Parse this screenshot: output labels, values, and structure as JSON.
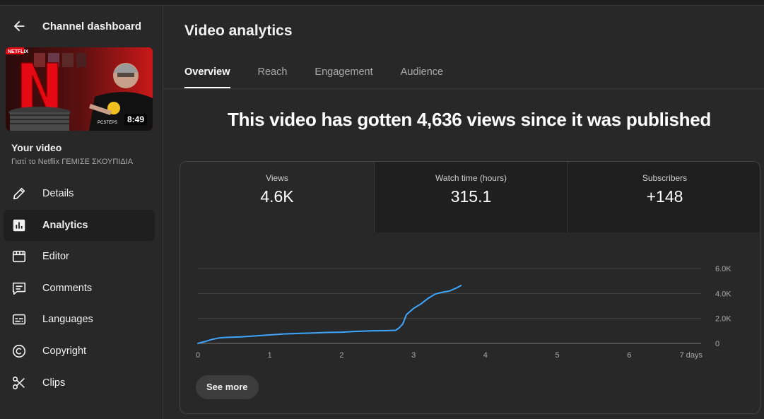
{
  "sidebar": {
    "header_title": "Channel dashboard",
    "video_duration": "8:49",
    "your_video_label": "Your video",
    "video_title": "Γιατί το Netflix ΓΕΜΙΣΕ ΣΚΟΥΠΙΔΙΑ",
    "items": [
      {
        "label": "Details",
        "icon": "pencil-icon"
      },
      {
        "label": "Analytics",
        "icon": "analytics-icon",
        "active": true
      },
      {
        "label": "Editor",
        "icon": "editor-icon"
      },
      {
        "label": "Comments",
        "icon": "comments-icon"
      },
      {
        "label": "Languages",
        "icon": "subtitles-icon"
      },
      {
        "label": "Copyright",
        "icon": "copyright-icon"
      },
      {
        "label": "Clips",
        "icon": "scissors-icon"
      }
    ]
  },
  "main": {
    "title": "Video analytics",
    "tabs": [
      "Overview",
      "Reach",
      "Engagement",
      "Audience"
    ],
    "active_tab": "Overview",
    "headline": "This video has gotten 4,636 views since it was published",
    "metrics": [
      {
        "label": "Views",
        "value": "4.6K"
      },
      {
        "label": "Watch time (hours)",
        "value": "315.1"
      },
      {
        "label": "Subscribers",
        "value": "+148"
      }
    ],
    "see_more_label": "See more"
  },
  "chart_data": {
    "type": "line",
    "x_tick_labels": [
      "0",
      "1",
      "2",
      "3",
      "4",
      "5",
      "6",
      "7 days"
    ],
    "y_tick_labels": [
      "0",
      "2.0K",
      "4.0K",
      "6.0K"
    ],
    "xlim": [
      0,
      7
    ],
    "ylim": [
      0,
      6000
    ],
    "grid": true,
    "line_color": "#3ea6ff",
    "series": [
      {
        "x": [
          0,
          0.1,
          0.2,
          0.3,
          0.4,
          0.6,
          0.8,
          1.0,
          1.2,
          1.4,
          1.6,
          1.8,
          2.0,
          2.2,
          2.4,
          2.6,
          2.75,
          2.8,
          2.85,
          2.9,
          3.0,
          3.1,
          3.2,
          3.3,
          3.4,
          3.5,
          3.6,
          3.66
        ],
        "y": [
          0,
          150,
          320,
          440,
          480,
          520,
          600,
          680,
          760,
          800,
          840,
          880,
          900,
          960,
          1000,
          1020,
          1050,
          1250,
          1550,
          2300,
          2800,
          3150,
          3600,
          3950,
          4100,
          4200,
          4450,
          4636
        ]
      }
    ]
  }
}
